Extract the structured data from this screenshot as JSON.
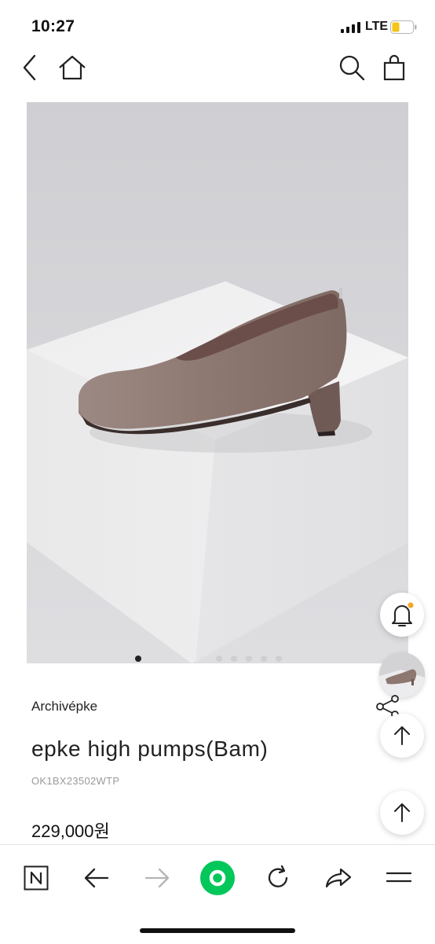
{
  "status_bar": {
    "time": "10:27",
    "network": "LTE",
    "battery_color": "#f5c518"
  },
  "top_nav": {
    "icons": [
      "back-icon",
      "home-icon",
      "search-icon",
      "shopping-bag-icon"
    ]
  },
  "gallery": {
    "total_images": 6,
    "current_index": 1
  },
  "floating": {
    "notification_dot_color": "#f5a623",
    "icons": [
      "bell-icon",
      "scroll-top-icon"
    ]
  },
  "product": {
    "brand": "Archivépke",
    "name": "epke high pumps(Bam)",
    "code": "OK1BX23502WTP",
    "price": "229,000원"
  },
  "bottom_bar": {
    "icons": [
      "naver-n-icon",
      "back-arrow-icon",
      "forward-arrow-icon",
      "green-dot-icon",
      "refresh-icon",
      "share-arrow-icon",
      "menu-icon"
    ],
    "accent_color": "#03c75a"
  }
}
